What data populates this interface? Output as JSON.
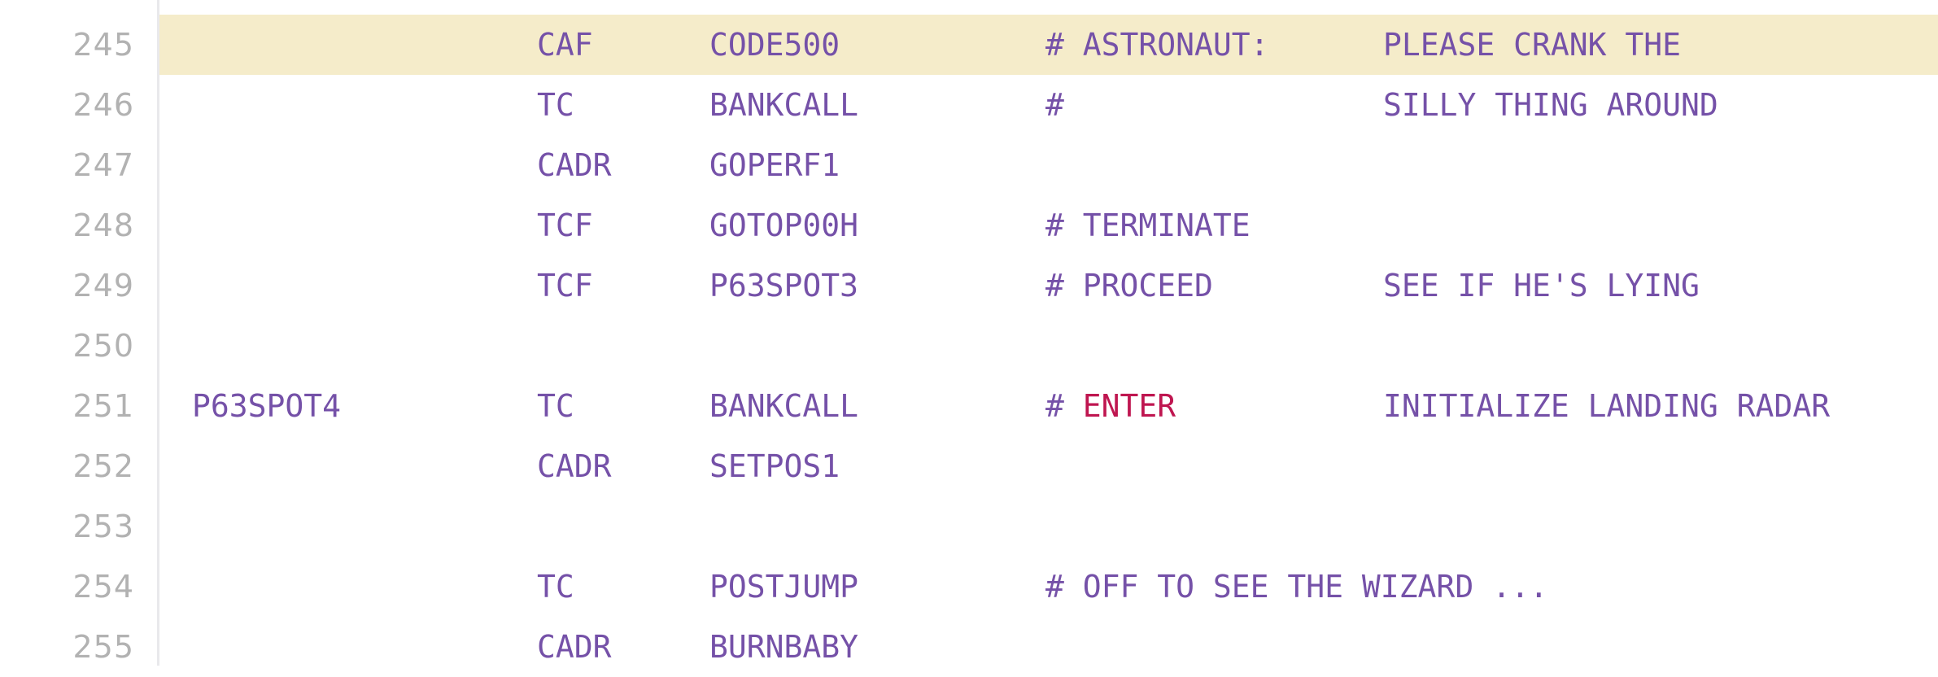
{
  "editor": {
    "kind": "code-viewer",
    "language": "Apollo Guidance Computer assembly",
    "colors": {
      "background": "#ffffff",
      "gutter_divider": "#e9e9ec",
      "line_number": "#b2b2b2",
      "code_text": "#7551a8",
      "keyword": "#bf1650",
      "highlight_row": "#f5ecca"
    },
    "first_line_number": 245,
    "last_line_number": 255,
    "highlighted_line": 245
  },
  "lines": [
    {
      "number": "245",
      "highlighted": true,
      "label": "",
      "opcode": "CAF",
      "operand": "CODE500",
      "comment": "# ASTRONAUT:",
      "tail": "PLEASE CRANK THE",
      "keyword": ""
    },
    {
      "number": "246",
      "highlighted": false,
      "label": "",
      "opcode": "TC",
      "operand": "BANKCALL",
      "comment": "#",
      "tail": "SILLY THING AROUND",
      "keyword": ""
    },
    {
      "number": "247",
      "highlighted": false,
      "label": "",
      "opcode": "CADR",
      "operand": "GOPERF1",
      "comment": "",
      "tail": "",
      "keyword": ""
    },
    {
      "number": "248",
      "highlighted": false,
      "label": "",
      "opcode": "TCF",
      "operand": "GOTOP00H",
      "comment": "# TERMINATE",
      "tail": "",
      "keyword": ""
    },
    {
      "number": "249",
      "highlighted": false,
      "label": "",
      "opcode": "TCF",
      "operand": "P63SPOT3",
      "comment": "# PROCEED",
      "tail": "SEE IF HE'S LYING",
      "keyword": ""
    },
    {
      "number": "250",
      "highlighted": false,
      "label": "",
      "opcode": "",
      "operand": "",
      "comment": "",
      "tail": "",
      "keyword": ""
    },
    {
      "number": "251",
      "highlighted": false,
      "label": "P63SPOT4",
      "opcode": "TC",
      "operand": "BANKCALL",
      "comment": "# ",
      "keyword": "ENTER",
      "tail": "INITIALIZE LANDING RADAR"
    },
    {
      "number": "252",
      "highlighted": false,
      "label": "",
      "opcode": "CADR",
      "operand": "SETPOS1",
      "comment": "",
      "tail": "",
      "keyword": ""
    },
    {
      "number": "253",
      "highlighted": false,
      "label": "",
      "opcode": "",
      "operand": "",
      "comment": "",
      "tail": "",
      "keyword": ""
    },
    {
      "number": "254",
      "highlighted": false,
      "label": "",
      "opcode": "TC",
      "operand": "POSTJUMP",
      "comment": "# OFF TO SEE THE WIZARD ...",
      "tail": "",
      "keyword": ""
    },
    {
      "number": "255",
      "highlighted": false,
      "label": "",
      "opcode": "CADR",
      "operand": "BURNBABY",
      "comment": "",
      "tail": "",
      "keyword": ""
    }
  ]
}
